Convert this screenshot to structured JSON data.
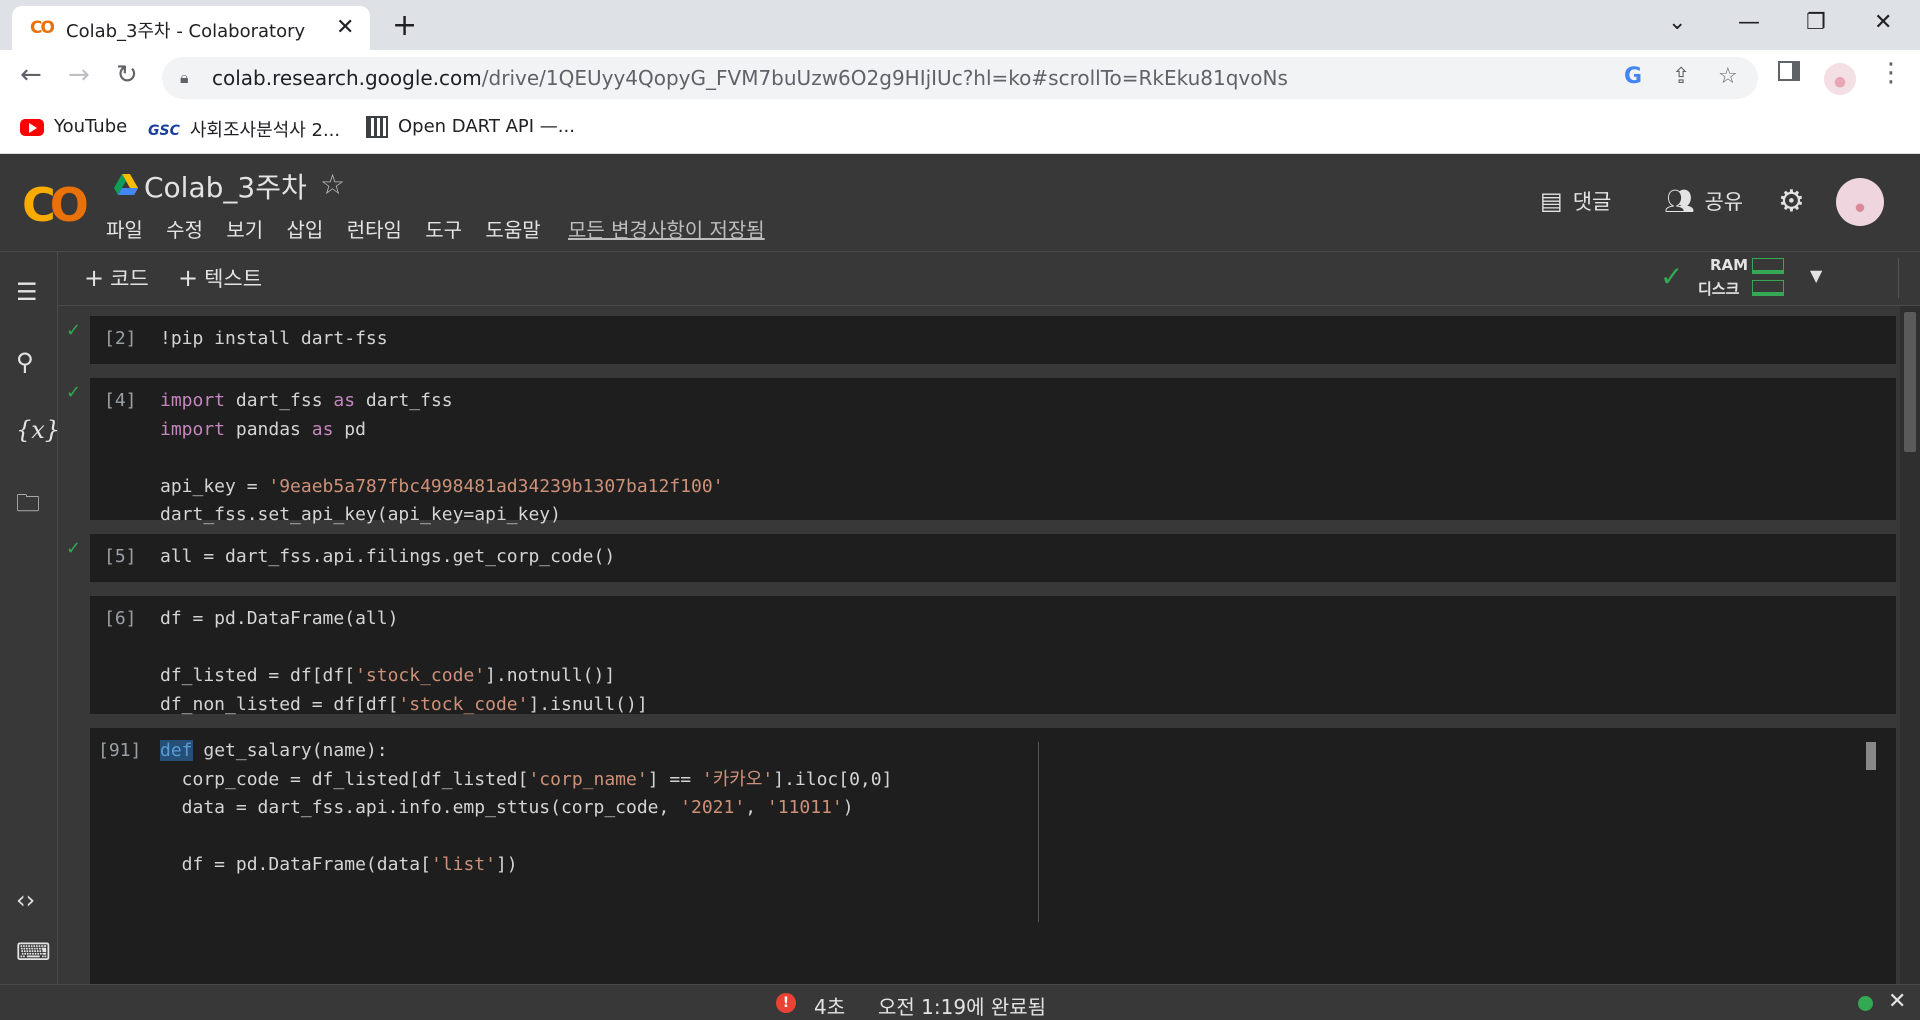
{
  "browser": {
    "tab_title": "Colab_3주차 - Colaboratory",
    "tab_favicon": "CO",
    "url_host": "colab.research.google.com",
    "url_path": "/drive/1QEUyy4QopyG_FVM7buUzw6O2g9HIjIUc?hl=ko#scrollTo=RkEku81qvoNs",
    "bookmarks": [
      {
        "label": "YouTube",
        "icon": "youtube-icon"
      },
      {
        "label": "사회조사분석사 2...",
        "icon": "gsc-icon"
      },
      {
        "label": "Open DART API —...",
        "icon": "dart-icon"
      }
    ]
  },
  "colab": {
    "title": "Colab_3주차",
    "menu": [
      "파일",
      "수정",
      "보기",
      "삽입",
      "런타임",
      "도구",
      "도움말"
    ],
    "saved_status": "모든 변경사항이 저장됨",
    "comment_label": "댓글",
    "share_label": "공유",
    "toolbar": {
      "add_code": "코드",
      "add_text": "텍스트",
      "ram_label": "RAM",
      "disk_label": "디스크"
    }
  },
  "cells": [
    {
      "exec": "[2]",
      "executed": true,
      "lines": [
        "!pip install dart-fss"
      ]
    },
    {
      "exec": "[4]",
      "executed": true,
      "lines": [
        "import dart_fss as dart_fss",
        "import pandas as pd",
        "",
        "api_key = '9eaeb5a787fbc4998481ad34239b1307ba12f100'",
        "dart_fss.set_api_key(api_key=api_key)"
      ]
    },
    {
      "exec": "[5]",
      "executed": true,
      "lines": [
        "all = dart_fss.api.filings.get_corp_code()"
      ]
    },
    {
      "exec": "[6]",
      "executed": false,
      "lines": [
        "df = pd.DataFrame(all)",
        "",
        "df_listed = df[df['stock_code'].notnull()]",
        "df_non_listed = df[df['stock_code'].isnull()]"
      ]
    },
    {
      "exec": "[91]",
      "executed": false,
      "lines": [
        "def get_salary(name):",
        "  corp_code = df_listed[df_listed['corp_name'] == '카카오'].iloc[0,0]",
        "  data = dart_fss.api.info.emp_sttus(corp_code, '2021', '11011')",
        "",
        "  df = pd.DataFrame(data['list'])"
      ]
    }
  ],
  "status": {
    "error_icon": "!",
    "duration": "4초",
    "completed": "오전 1:19에 완료됨"
  },
  "colors": {
    "accent_green": "#34a853",
    "error_red": "#ea4335",
    "colab_orange": "#f9ab00"
  }
}
